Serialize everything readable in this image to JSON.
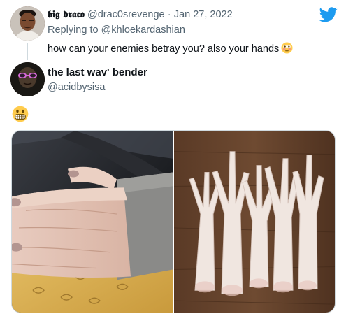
{
  "app": {
    "logo_icon": "twitter-bird-icon",
    "brand_color": "#1d9bf0"
  },
  "reply_tweet": {
    "display_name": "𝖇𝖎𝖌 𝖉𝖗𝖆𝖈𝖔",
    "handle": "@drac0srevenge",
    "separator": "·",
    "date": "Jan 27, 2022",
    "replying_to_prefix": "Replying to",
    "replying_to_handle": "@khloekardashian",
    "text": "how can your enemies betray you? also your hands",
    "emoji": "flushed-face-emoji"
  },
  "main_tweet": {
    "display_name": "the last wav' bender",
    "handle": "@acidbysisa",
    "emoji": "grimacing-face-emoji",
    "media": [
      {
        "name": "hand-photo",
        "description_icon": "photo"
      },
      {
        "name": "chicken-feet-photo",
        "description_icon": "photo"
      }
    ]
  }
}
